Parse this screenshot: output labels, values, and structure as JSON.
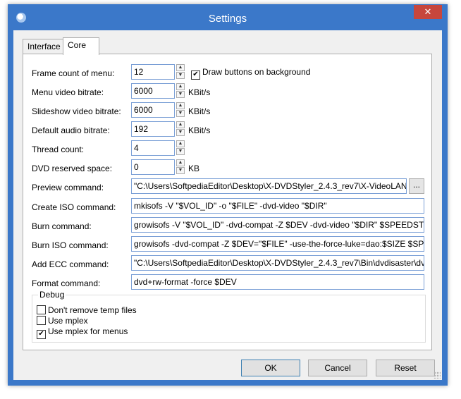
{
  "window": {
    "title": "Settings",
    "close_label": "✕"
  },
  "tabs": [
    {
      "label": "Interface"
    },
    {
      "label": "Core"
    }
  ],
  "fields": {
    "frame_count": {
      "label": "Frame count of menu:",
      "value": "12"
    },
    "draw_buttons": {
      "label": "Draw buttons on background",
      "checked": true
    },
    "menu_bitrate": {
      "label": "Menu video bitrate:",
      "value": "6000",
      "unit": "KBit/s"
    },
    "slideshow_bitrate": {
      "label": "Slideshow video bitrate:",
      "value": "6000",
      "unit": "KBit/s"
    },
    "audio_bitrate": {
      "label": "Default audio bitrate:",
      "value": "192",
      "unit": "KBit/s"
    },
    "thread_count": {
      "label": "Thread count:",
      "value": "4"
    },
    "dvd_reserved": {
      "label": "DVD reserved space:",
      "value": "0",
      "unit": "KB"
    },
    "preview_cmd": {
      "label": "Preview command:",
      "value": "\"C:\\Users\\SoftpediaEditor\\Desktop\\X-DVDStyler_2.4.3_rev7\\X-VideoLAN.e",
      "browse": "..."
    },
    "iso_cmd": {
      "label": "Create ISO command:",
      "value": "mkisofs -V \"$VOL_ID\" -o \"$FILE\" -dvd-video \"$DIR\""
    },
    "burn_cmd": {
      "label": "Burn command:",
      "value": "growisofs -V \"$VOL_ID\" -dvd-compat -Z $DEV -dvd-video \"$DIR\" $SPEEDSTR"
    },
    "burn_iso_cmd": {
      "label": "Burn ISO command:",
      "value": "growisofs -dvd-compat -Z $DEV=\"$FILE\" -use-the-force-luke=dao:$SIZE $SPEI"
    },
    "ecc_cmd": {
      "label": "Add ECC command:",
      "value": "\"C:\\Users\\SoftpediaEditor\\Desktop\\X-DVDStyler_2.4.3_rev7\\Bin\\dvdisaster\\dvc"
    },
    "format_cmd": {
      "label": "Format command:",
      "value": "dvd+rw-format -force $DEV"
    }
  },
  "debug": {
    "legend": "Debug",
    "options": [
      {
        "label": "Don't remove temp files",
        "checked": false,
        "mark": ""
      },
      {
        "label": "Use mplex",
        "checked": false,
        "mark": ""
      },
      {
        "label": "Use mplex for menus",
        "checked": true,
        "mark": "✔"
      }
    ]
  },
  "buttons": {
    "ok": "OK",
    "cancel": "Cancel",
    "reset": "Reset"
  },
  "spin_glyphs": {
    "up": "▲",
    "down": "▼"
  },
  "colors": {
    "titlebar": "#3b78c9",
    "close": "#c7463d",
    "input_border": "#7a9fd6"
  }
}
